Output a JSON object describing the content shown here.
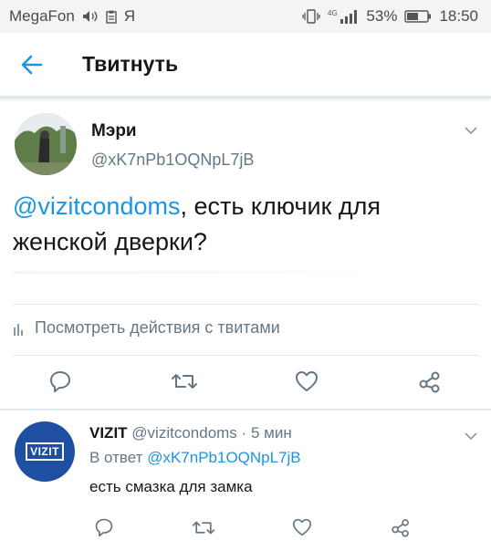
{
  "status_bar": {
    "carrier": "MegaFon",
    "carrier_extra": "Я",
    "network": "4G",
    "battery": "53%",
    "time": "18:50"
  },
  "header": {
    "title": "Твитнуть"
  },
  "tweet": {
    "author_name": "Мэри",
    "author_handle": "@xK7nPb1OQNpL7jB",
    "mention": "@vizitcondoms",
    "text": ", есть ключик для женской дверки?",
    "analytics_label": "Посмотреть действия с твитами"
  },
  "reply": {
    "author_name": "VIZIT",
    "author_handle": "@vizitcondoms",
    "separator": "·",
    "time": "5 мин",
    "reply_prefix": "В ответ",
    "reply_to": "@xK7nPb1OQNpL7jB",
    "text": "есть смазка для замка",
    "avatar_text": "VIZIT"
  },
  "icons": {
    "back": "arrow-left-icon",
    "more": "chevron-down-icon",
    "reply": "speech-bubble-icon",
    "retweet": "retweet-icon",
    "like": "heart-icon",
    "share": "share-icon",
    "analytics": "bar-chart-icon"
  },
  "colors": {
    "accent": "#1b95e0",
    "secondary_text": "#657786",
    "brand_vizit": "#1e4fa0"
  }
}
